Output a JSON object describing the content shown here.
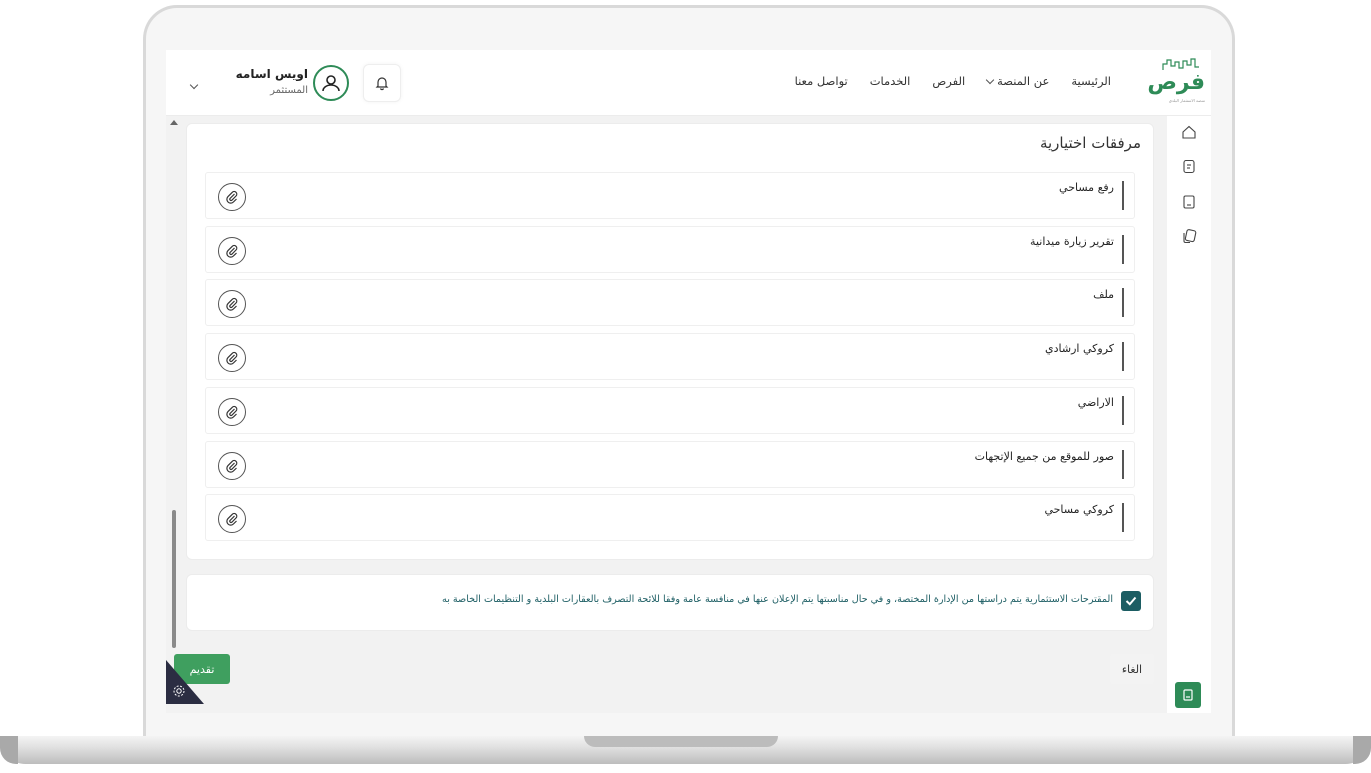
{
  "header": {
    "logo_text": "فرص",
    "logo_sub": "منصة الاستثمار البلدي",
    "nav": [
      "الرئيسية",
      "عن المنصة",
      "الفرص",
      "الخدمات",
      "تواصل معنا"
    ],
    "user_name": "اويس اسامه",
    "user_role": "المستثمر"
  },
  "section": {
    "title": "مرفقات اختيارية",
    "attachments": [
      "رفع مساحي",
      "تقرير زيارة ميدانية",
      "ملف",
      "كروكي ارشادي",
      "الاراضي",
      "صور للموقع من جميع الإتجهات",
      "كروكي مساحي"
    ]
  },
  "agreement": {
    "checked": true,
    "text": "المقترحات الاستثمارية يتم دراستها من الإدارة المختصة، و في حال مناسبتها يتم الإعلان عنها في منافسة عامة وفقا للائحة التصرف بالعقارات البلدية و التنظيمات الخاصة به"
  },
  "actions": {
    "cancel": "الغاء",
    "submit": "تقديم"
  },
  "colors": {
    "brand": "#2e8b57",
    "submit": "#3f9f5f",
    "agree_text": "#1c5d63",
    "corner": "#2b2d42"
  }
}
